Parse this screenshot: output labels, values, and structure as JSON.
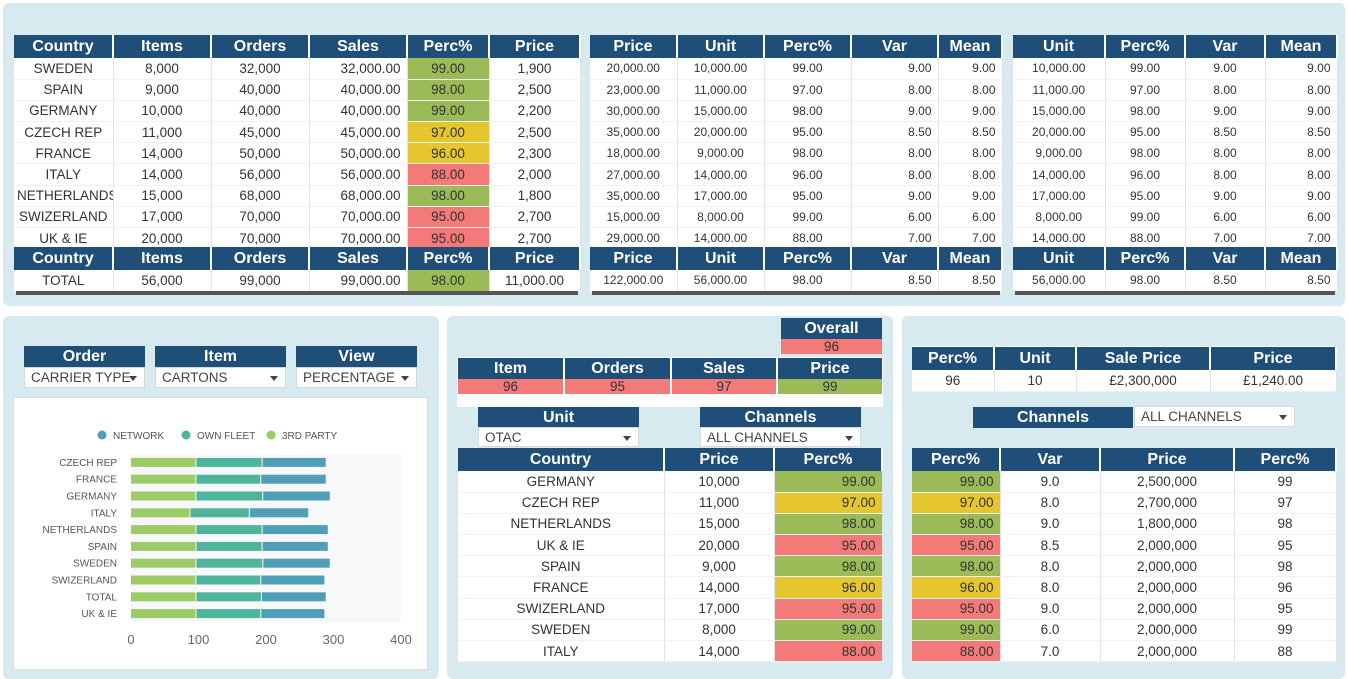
{
  "t1": {
    "headers": [
      "Country",
      "Items",
      "Orders",
      "Sales",
      "Perc%",
      "Price"
    ],
    "rows": [
      {
        "c": "SWEDEN",
        "items": "8,000",
        "orders": "32,000",
        "sales": "32,000.00",
        "perc": "99.00",
        "pc": "g",
        "price": "1,900"
      },
      {
        "c": "SPAIN",
        "items": "9,000",
        "orders": "40,000",
        "sales": "40,000.00",
        "perc": "98.00",
        "pc": "g",
        "price": "2,500"
      },
      {
        "c": "GERMANY",
        "items": "10,000",
        "orders": "40,000",
        "sales": "40,000.00",
        "perc": "99.00",
        "pc": "g",
        "price": "2,200"
      },
      {
        "c": "CZECH REP",
        "items": "11,000",
        "orders": "45,000",
        "sales": "45,000.00",
        "perc": "97.00",
        "pc": "y",
        "price": "2,500"
      },
      {
        "c": "FRANCE",
        "items": "14,000",
        "orders": "50,000",
        "sales": "50,000.00",
        "perc": "96.00",
        "pc": "y",
        "price": "2,300"
      },
      {
        "c": "ITALY",
        "items": "14,000",
        "orders": "56,000",
        "sales": "56,000.00",
        "perc": "88.00",
        "pc": "rd",
        "price": "2,000"
      },
      {
        "c": "NETHERLANDS",
        "items": "15,000",
        "orders": "68,000",
        "sales": "68,000.00",
        "perc": "98.00",
        "pc": "g",
        "price": "1,800"
      },
      {
        "c": "SWIZERLAND",
        "items": "17,000",
        "orders": "70,000",
        "sales": "70,000.00",
        "perc": "95.00",
        "pc": "rd",
        "price": "2,700"
      },
      {
        "c": "UK & IE",
        "items": "20,000",
        "orders": "70,000",
        "sales": "70,000.00",
        "perc": "95.00",
        "pc": "rd",
        "price": "2,700"
      }
    ],
    "total": {
      "c": "TOTAL",
      "items": "56,000",
      "orders": "99,000",
      "sales": "99,000.00",
      "perc": "98.00",
      "pc": "g",
      "price": "11,000.00"
    }
  },
  "t2": {
    "headers": [
      "Price",
      "Unit",
      "Perc%",
      "Var",
      "Mean"
    ],
    "rows": [
      [
        "20,000.00",
        "10,000.00",
        "99.00",
        "9.00",
        "9.00"
      ],
      [
        "23,000.00",
        "11,000.00",
        "97.00",
        "8.00",
        "8.00"
      ],
      [
        "30,000.00",
        "15,000.00",
        "98.00",
        "9.00",
        "9.00"
      ],
      [
        "35,000.00",
        "20,000.00",
        "95.00",
        "8.50",
        "8.50"
      ],
      [
        "18,000.00",
        "9,000.00",
        "98.00",
        "8.00",
        "8.00"
      ],
      [
        "27,000.00",
        "14,000.00",
        "96.00",
        "8.00",
        "8.00"
      ],
      [
        "35,000.00",
        "17,000.00",
        "95.00",
        "9.00",
        "9.00"
      ],
      [
        "15,000.00",
        "8,000.00",
        "99.00",
        "6.00",
        "6.00"
      ],
      [
        "29,000.00",
        "14,000.00",
        "88.00",
        "7.00",
        "7.00"
      ]
    ],
    "total": [
      "122,000.00",
      "56,000.00",
      "98.00",
      "8.50",
      "8.50"
    ]
  },
  "t3": {
    "headers": [
      "Unit",
      "Perc%",
      "Var",
      "Mean"
    ],
    "rows": [
      [
        "10,000.00",
        "99.00",
        "9.00",
        "9.00"
      ],
      [
        "11,000.00",
        "97.00",
        "8.00",
        "8.00"
      ],
      [
        "15,000.00",
        "98.00",
        "9.00",
        "9.00"
      ],
      [
        "20,000.00",
        "95.00",
        "8.50",
        "8.50"
      ],
      [
        "9,000.00",
        "98.00",
        "8.00",
        "8.00"
      ],
      [
        "14,000.00",
        "96.00",
        "8.00",
        "8.00"
      ],
      [
        "17,000.00",
        "95.00",
        "9.00",
        "9.00"
      ],
      [
        "8,000.00",
        "99.00",
        "6.00",
        "6.00"
      ],
      [
        "14,000.00",
        "88.00",
        "7.00",
        "7.00"
      ]
    ],
    "total": [
      "56,000.00",
      "98.00",
      "8.50",
      "8.50"
    ]
  },
  "filters": {
    "order_label": "Order",
    "order_value": "CARRIER TYPE",
    "item_label": "Item",
    "item_value": "CARTONS",
    "view_label": "View",
    "view_value": "PERCENTAGE"
  },
  "chart_data": {
    "type": "bar",
    "orientation": "horizontal",
    "stacked": true,
    "categories": [
      "CZECH REP",
      "FRANCE",
      "GERMANY",
      "ITALY",
      "NETHERLANDS",
      "SPAIN",
      "SWEDEN",
      "SWIZERLAND",
      "TOTAL",
      "UK & IE"
    ],
    "series": [
      {
        "name": "NETWORK",
        "color": "#4f9fb8",
        "values": [
          95,
          97,
          100,
          88,
          98,
          98,
          100,
          95,
          96,
          95
        ]
      },
      {
        "name": "OWN FLEET",
        "color": "#4fb59a",
        "values": [
          98,
          96,
          99,
          88,
          98,
          98,
          99,
          96,
          97,
          96
        ]
      },
      {
        "name": "3RD PARTY",
        "color": "#9ccc65",
        "values": [
          97,
          97,
          97,
          88,
          97,
          97,
          97,
          97,
          97,
          97
        ]
      }
    ],
    "xlim": [
      0,
      400
    ],
    "xticks": [
      "0",
      "100",
      "200",
      "300",
      "400"
    ],
    "legend": "top"
  },
  "overall": {
    "label": "Overall",
    "value": "96"
  },
  "mid_kpi": {
    "headers": [
      "Item",
      "Orders",
      "Sales",
      "Price"
    ],
    "values": [
      {
        "v": "96",
        "c": "rd"
      },
      {
        "v": "95",
        "c": "rd"
      },
      {
        "v": "97",
        "c": "rd"
      },
      {
        "v": "99",
        "c": "g"
      }
    ]
  },
  "mid_filters": {
    "unit_label": "Unit",
    "unit_value": "OTAC",
    "channels_label": "Channels",
    "channels_value": "ALL CHANNELS"
  },
  "mid_table": {
    "headers": [
      "Country",
      "Price",
      "Perc%"
    ],
    "rows": [
      {
        "c": "GERMANY",
        "price": "10,000",
        "perc": "99.00",
        "pc": "g"
      },
      {
        "c": "CZECH REP",
        "price": "11,000",
        "perc": "97.00",
        "pc": "y"
      },
      {
        "c": "NETHERLANDS",
        "price": "15,000",
        "perc": "98.00",
        "pc": "g"
      },
      {
        "c": "UK & IE",
        "price": "20,000",
        "perc": "95.00",
        "pc": "rd"
      },
      {
        "c": "SPAIN",
        "price": "9,000",
        "perc": "98.00",
        "pc": "g"
      },
      {
        "c": "FRANCE",
        "price": "14,000",
        "perc": "96.00",
        "pc": "y"
      },
      {
        "c": "SWIZERLAND",
        "price": "17,000",
        "perc": "95.00",
        "pc": "rd"
      },
      {
        "c": "SWEDEN",
        "price": "8,000",
        "perc": "99.00",
        "pc": "g"
      },
      {
        "c": "ITALY",
        "price": "14,000",
        "perc": "88.00",
        "pc": "rd"
      }
    ]
  },
  "right_kpi": {
    "headers": [
      "Perc%",
      "Unit",
      "Sale Price",
      "Price"
    ],
    "values": [
      "96",
      "10",
      "£2,300,000",
      "£1,240.00"
    ]
  },
  "right_filters": {
    "channels_label": "Channels",
    "channels_value": "ALL CHANNELS"
  },
  "right_table": {
    "headers": [
      "Perc%",
      "Var",
      "Price",
      "Perc%"
    ],
    "rows": [
      {
        "perc": "99.00",
        "pc": "g",
        "var": "9.0",
        "price": "2,500,000",
        "p2": "99"
      },
      {
        "perc": "97.00",
        "pc": "y",
        "var": "8.0",
        "price": "2,700,000",
        "p2": "97"
      },
      {
        "perc": "98.00",
        "pc": "g",
        "var": "9.0",
        "price": "1,800,000",
        "p2": "98"
      },
      {
        "perc": "95.00",
        "pc": "rd",
        "var": "8.5",
        "price": "2,000,000",
        "p2": "95"
      },
      {
        "perc": "98.00",
        "pc": "g",
        "var": "8.0",
        "price": "2,000,000",
        "p2": "98"
      },
      {
        "perc": "96.00",
        "pc": "y",
        "var": "8.0",
        "price": "2,000,000",
        "p2": "96"
      },
      {
        "perc": "95.00",
        "pc": "rd",
        "var": "9.0",
        "price": "2,000,000",
        "p2": "95"
      },
      {
        "perc": "99.00",
        "pc": "g",
        "var": "6.0",
        "price": "2,000,000",
        "p2": "99"
      },
      {
        "perc": "88.00",
        "pc": "rd",
        "var": "7.0",
        "price": "2,000,000",
        "p2": "88"
      }
    ]
  }
}
